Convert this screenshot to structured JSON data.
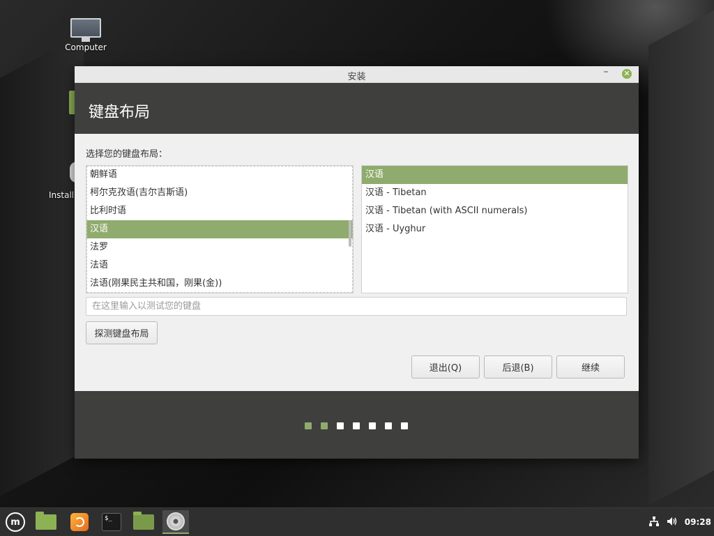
{
  "desktop": {
    "icons": [
      {
        "name": "computer",
        "label": "Computer"
      },
      {
        "name": "install",
        "label": "Install"
      }
    ]
  },
  "window": {
    "title": "安装",
    "header_title": "键盘布局",
    "prompt": "选择您的键盘布局：",
    "layouts": [
      {
        "label": "朝鲜语",
        "selected": false
      },
      {
        "label": "柯尔克孜语(吉尔吉斯语)",
        "selected": false
      },
      {
        "label": "比利时语",
        "selected": false
      },
      {
        "label": "汉语",
        "selected": true
      },
      {
        "label": "法罗",
        "selected": false
      },
      {
        "label": "法语",
        "selected": false
      },
      {
        "label": "法语(刚果民主共和国，刚果(金))",
        "selected": false
      }
    ],
    "variants": [
      {
        "label": "汉语",
        "selected": true
      },
      {
        "label": "汉语 - Tibetan",
        "selected": false
      },
      {
        "label": "汉语 - Tibetan (with ASCII numerals)",
        "selected": false
      },
      {
        "label": "汉语 - Uyghur",
        "selected": false
      }
    ],
    "test_input": {
      "value": "",
      "placeholder": "在这里输入以测试您的键盘"
    },
    "buttons": {
      "detect": "探测键盘布局",
      "quit": "退出(Q)",
      "back": "后退(B)",
      "continue": "继续"
    },
    "progress": {
      "total_steps": 7,
      "completed_steps": 2
    }
  },
  "taskbar": {
    "clock": "09:28"
  },
  "colors": {
    "accent": "#8fab6d",
    "header_bg": "#3f3f3e",
    "taskbar_bg": "#2f2f2f"
  }
}
